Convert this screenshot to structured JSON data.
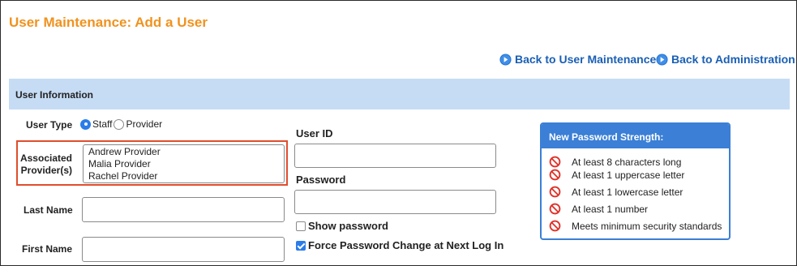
{
  "page": {
    "title": "User Maintenance: Add a User"
  },
  "nav": {
    "back_user_maintenance": "Back to User Maintenance",
    "back_administration": "Back to Administration"
  },
  "section": {
    "title": "User Information"
  },
  "form": {
    "user_type_label": "User Type",
    "user_type_options": [
      "Staff",
      "Provider"
    ],
    "user_type_selected": "Staff",
    "associated_providers_label": "Associated Provider(s)",
    "associated_providers": [
      "Andrew Provider",
      "Malia Provider",
      "Rachel Provider"
    ],
    "last_name_label": "Last Name",
    "last_name_value": "",
    "first_name_label": "First Name",
    "first_name_value": "",
    "user_id_label": "User ID",
    "user_id_value": "",
    "password_label": "Password",
    "password_value": "",
    "show_password_label": "Show password",
    "show_password_checked": false,
    "force_change_label": "Force Password Change at Next Log In",
    "force_change_checked": true
  },
  "password_strength": {
    "title": "New Password Strength:",
    "rules": [
      "At least 8 characters long",
      "At least 1 uppercase letter",
      "At least 1 lowercase letter",
      "At least 1 number",
      "Meets minimum security standards"
    ],
    "status_icon": "no-entry-icon"
  },
  "colors": {
    "title": "#f0921e",
    "link": "#1a5fb4",
    "section_bar": "#c6dcf5",
    "accent": "#3b7fd6",
    "highlight": "#e04e2e",
    "fail": "#e0332b"
  }
}
